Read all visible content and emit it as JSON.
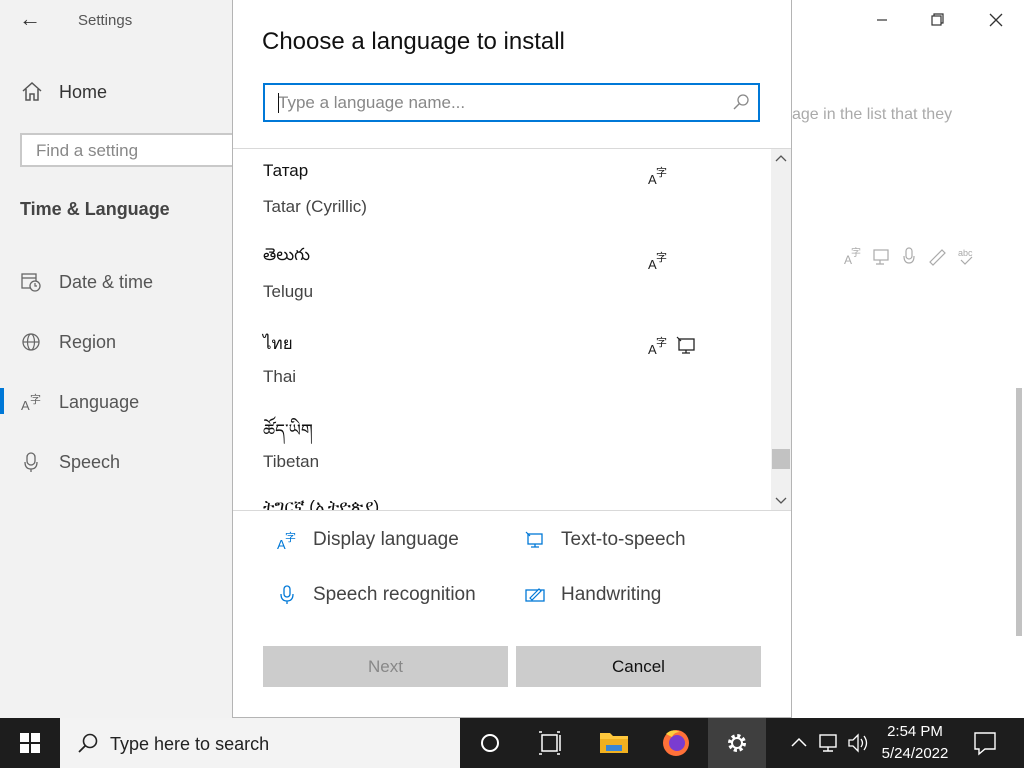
{
  "window": {
    "app_title": "Settings",
    "back_icon": "back-arrow-icon",
    "min_icon": "minimize-icon",
    "max_icon": "maximize-icon",
    "close_icon": "close-icon"
  },
  "sidebar": {
    "home_label": "Home",
    "search_placeholder": "Find a setting",
    "section_title": "Time & Language",
    "items": [
      {
        "label": "Date & time",
        "icon": "calendar-clock-icon"
      },
      {
        "label": "Region",
        "icon": "globe-icon"
      },
      {
        "label": "Language",
        "icon": "language-icon"
      },
      {
        "label": "Speech",
        "icon": "microphone-icon"
      }
    ]
  },
  "background": {
    "partial_text": "age in the list that they"
  },
  "dialog": {
    "title": "Choose a language to install",
    "search_placeholder": "Type a language name...",
    "languages": [
      {
        "native": "Татар",
        "english": "Tatar (Cyrillic)",
        "features": [
          "display-language-icon"
        ]
      },
      {
        "native": "తెలుగు",
        "english": "Telugu",
        "features": [
          "display-language-icon"
        ]
      },
      {
        "native": "ไทย",
        "english": "Thai",
        "features": [
          "display-language-icon",
          "text-to-speech-icon"
        ]
      },
      {
        "native": "ཚོད་ཡིག",
        "english": "Tibetan",
        "features": []
      },
      {
        "native": "ትግርኛ (ኢትዮጵያ)",
        "english": "",
        "features": []
      }
    ],
    "legend": {
      "display_language": "Display language",
      "text_to_speech": "Text-to-speech",
      "speech_recognition": "Speech recognition",
      "handwriting": "Handwriting"
    },
    "next_label": "Next",
    "cancel_label": "Cancel"
  },
  "taskbar": {
    "search_placeholder": "Type here to search",
    "time": "2:54 PM",
    "date": "5/24/2022"
  },
  "colors": {
    "accent": "#0078d7",
    "firefox": "#ff7139",
    "folder": "#ffc83d"
  }
}
